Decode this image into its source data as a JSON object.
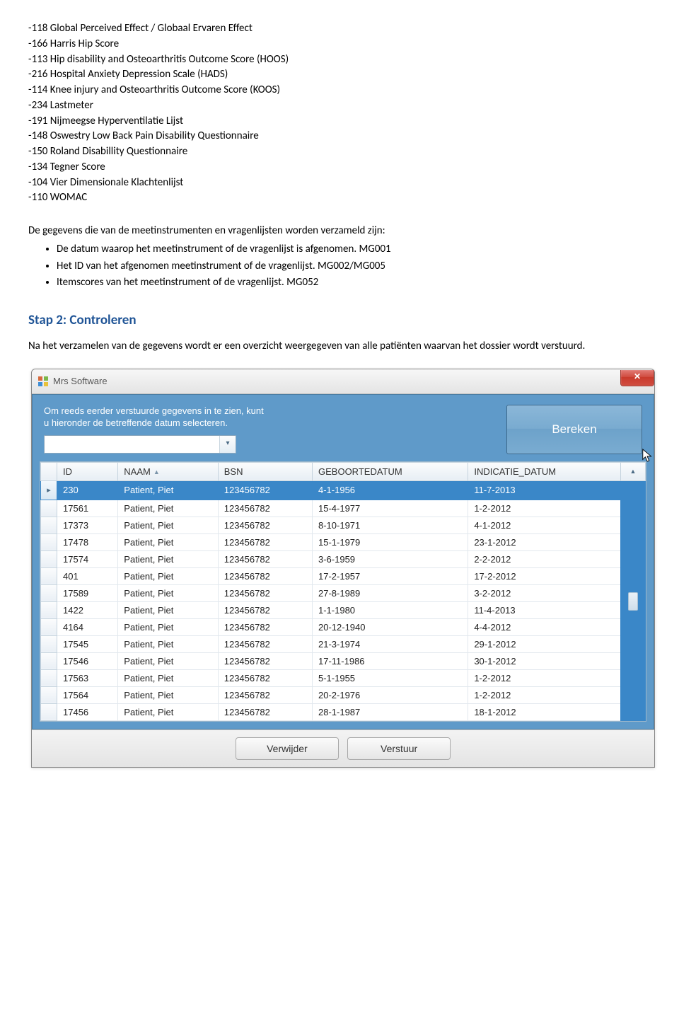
{
  "text_lines": [
    "-118 Global Perceived Effect / Globaal Ervaren Effect",
    "-166 Harris Hip Score",
    "-113 Hip disability and Osteoarthritis Outcome Score (HOOS)",
    "-216 Hospital Anxiety Depression Scale (HADS)",
    "-114 Knee injury and Osteoarthritis Outcome Score (KOOS)",
    "-234 Lastmeter",
    "-191 Nijmeegse Hyperventilatie Lijst",
    "-148 Oswestry Low Back Pain Disability Questionnaire",
    "-150 Roland Disabillity Questionnaire",
    "-134 Tegner Score",
    "-104 Vier Dimensionale Klachtenlijst",
    "-110 WOMAC"
  ],
  "paragraph_intro": "De gegevens die van de meetinstrumenten en vragenlijsten worden verzameld zijn:",
  "bullets": [
    "De datum waarop het meetinstrument of de vragenlijst is afgenomen. MG001",
    "Het ID van het afgenomen meetinstrument of de vragenlijst. MG002/MG005",
    "Itemscores van het meetinstrument of de vragenlijst. MG052"
  ],
  "step_heading": "Stap 2: Controleren",
  "paragraph2": "Na het verzamelen van de gegevens wordt er een overzicht weergegeven van alle patiënten waarvan het dossier wordt verstuurd.",
  "window": {
    "title": "Mrs Software",
    "info_text": "Om reeds eerder verstuurde gegevens in te zien, kunt u hieronder de betreffende datum selecteren.",
    "date_placeholder": "",
    "bereken_label": "Bereken",
    "columns": {
      "id": "ID",
      "naam": "NAAM",
      "bsn": "BSN",
      "geb": "GEBOORTEDATUM",
      "ind": "INDICATIE_DATUM"
    },
    "rows": [
      {
        "id": "230",
        "naam": "Patient, Piet",
        "bsn": "123456782",
        "geb": "4-1-1956",
        "ind": "11-7-2013"
      },
      {
        "id": "17561",
        "naam": "Patient, Piet",
        "bsn": "123456782",
        "geb": "15-4-1977",
        "ind": "1-2-2012"
      },
      {
        "id": "17373",
        "naam": "Patient, Piet",
        "bsn": "123456782",
        "geb": "8-10-1971",
        "ind": "4-1-2012"
      },
      {
        "id": "17478",
        "naam": "Patient, Piet",
        "bsn": "123456782",
        "geb": "15-1-1979",
        "ind": "23-1-2012"
      },
      {
        "id": "17574",
        "naam": "Patient, Piet",
        "bsn": "123456782",
        "geb": "3-6-1959",
        "ind": "2-2-2012"
      },
      {
        "id": "401",
        "naam": "Patient, Piet",
        "bsn": "123456782",
        "geb": "17-2-1957",
        "ind": "17-2-2012"
      },
      {
        "id": "17589",
        "naam": "Patient, Piet",
        "bsn": "123456782",
        "geb": "27-8-1989",
        "ind": "3-2-2012"
      },
      {
        "id": "1422",
        "naam": "Patient, Piet",
        "bsn": "123456782",
        "geb": "1-1-1980",
        "ind": "11-4-2013"
      },
      {
        "id": "4164",
        "naam": "Patient, Piet",
        "bsn": "123456782",
        "geb": "20-12-1940",
        "ind": "4-4-2012"
      },
      {
        "id": "17545",
        "naam": "Patient, Piet",
        "bsn": "123456782",
        "geb": "21-3-1974",
        "ind": "29-1-2012"
      },
      {
        "id": "17546",
        "naam": "Patient, Piet",
        "bsn": "123456782",
        "geb": "17-11-1986",
        "ind": "30-1-2012"
      },
      {
        "id": "17563",
        "naam": "Patient, Piet",
        "bsn": "123456782",
        "geb": "5-1-1955",
        "ind": "1-2-2012"
      },
      {
        "id": "17564",
        "naam": "Patient, Piet",
        "bsn": "123456782",
        "geb": "20-2-1976",
        "ind": "1-2-2012"
      },
      {
        "id": "17456",
        "naam": "Patient, Piet",
        "bsn": "123456782",
        "geb": "28-1-1987",
        "ind": "18-1-2012"
      }
    ],
    "verwijder_label": "Verwijder",
    "verstuur_label": "Verstuur"
  }
}
